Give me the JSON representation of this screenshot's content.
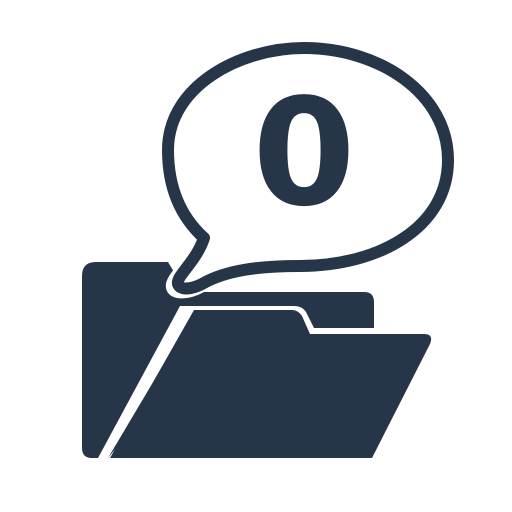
{
  "icon": {
    "name": "folder-with-speech-bubble-icon",
    "count": "0"
  },
  "colors": {
    "primary": "#263548",
    "background": "#ffffff"
  }
}
